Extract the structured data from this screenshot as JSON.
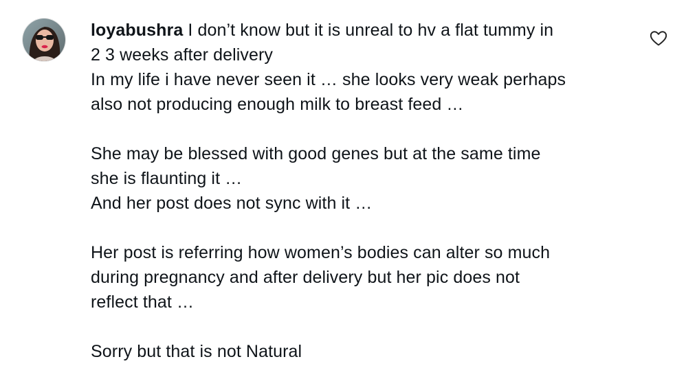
{
  "comment": {
    "username": "loyabushra",
    "lines": [
      "I don’t know but it is unreal to hv a flat tummy in",
      "2 3 weeks after delivery",
      "In my life i have never seen it … she looks very weak perhaps",
      "also not producing enough milk to breast feed …",
      "",
      "She may be blessed with good genes but at the same time",
      "she is flaunting it …",
      "And her post does not sync with it …",
      "",
      "Her post is referring how women’s bodies can alter so much",
      "during pregnancy and after delivery but her pic does not",
      "reflect that …",
      "",
      "Sorry but that is not Natural"
    ]
  },
  "icons": {
    "avatar": "user-avatar-photo",
    "like": "heart-outline-icon"
  },
  "colors": {
    "text": "#0f1419",
    "background": "#ffffff",
    "icon": "#262626"
  }
}
